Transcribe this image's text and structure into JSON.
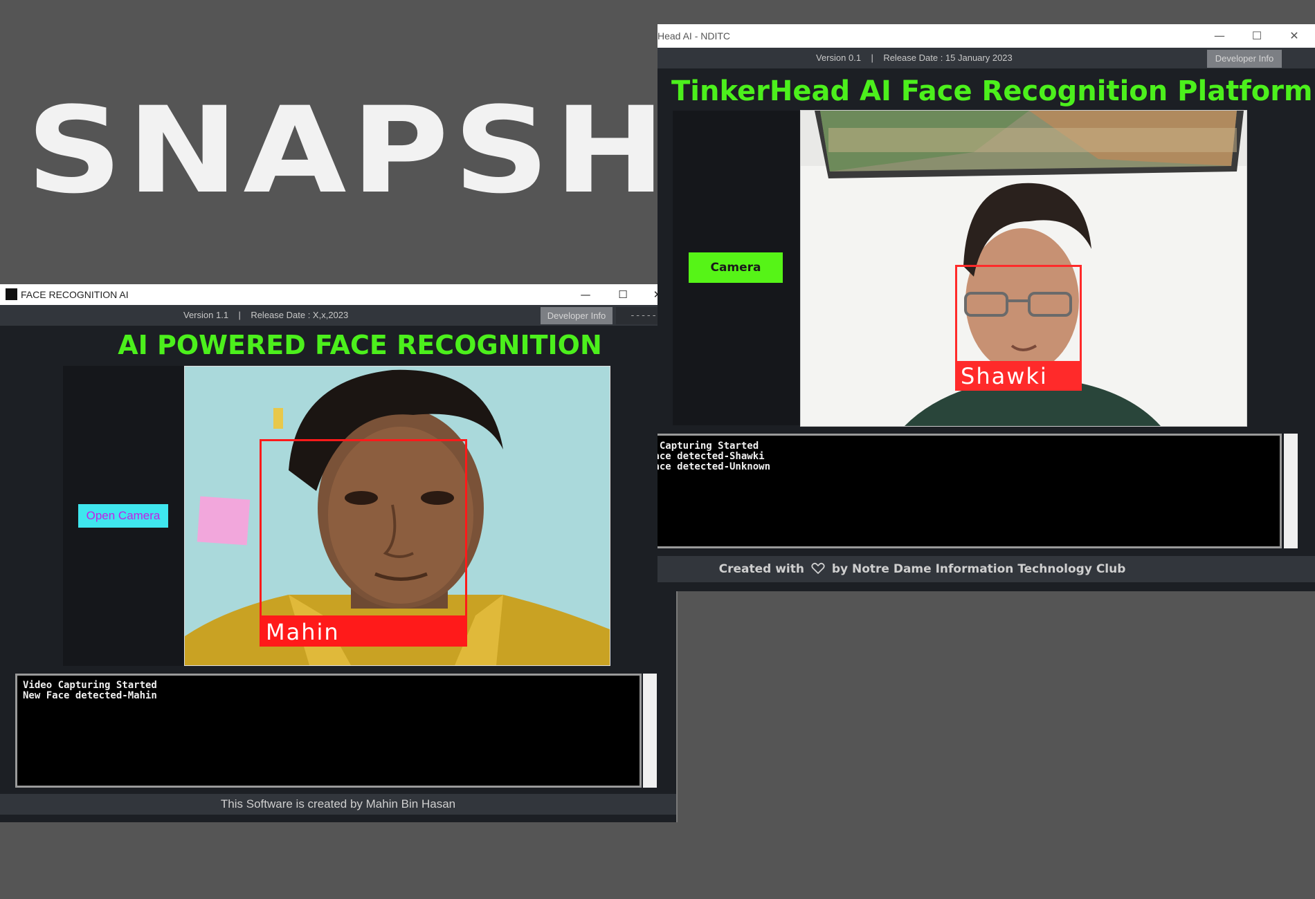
{
  "headline": "SNAPSHOTS",
  "window1": {
    "title": "FACE RECOGNITION AI",
    "controls": {
      "minimize": "—",
      "maximize": "☐",
      "close": "✕"
    },
    "version_text": "Version 1.1    |    Release Date : X,x,2023",
    "developer_button": "Developer Info",
    "extra_field": "-------",
    "heading": "AI POWERED FACE RECOGNITION",
    "open_camera_button": "Open Camera",
    "face_label": "Mahin",
    "log_text": "Video Capturing Started\nNew Face detected-Mahin",
    "footer": "This Software is created by Mahin Bin Hasan"
  },
  "window2": {
    "title": "Head AI - NDITC",
    "controls": {
      "minimize": "—",
      "maximize": "☐",
      "close": "✕"
    },
    "version_text": "Version 0.1    |    Release Date : 15 January 2023",
    "developer_button": "Developer Info",
    "heading": "TinkerHead AI Face Recognition Platform",
    "camera_button": "Camera",
    "face_label": "Shawki",
    "log_text": "o Capturing Started\nFace detected-Shawki\nFace detected-Unknown",
    "footer_before_icon": "Created with",
    "footer_icon": "heart-icon",
    "footer_after_icon": "by Notre Dame Information Technology Club"
  },
  "colors": {
    "accent_green": "#4cf01c",
    "detection_red": "#ff1a1a",
    "open_camera_bg": "#3fe6ee",
    "open_camera_text": "#c020e8",
    "camera_bg": "#56f417"
  }
}
